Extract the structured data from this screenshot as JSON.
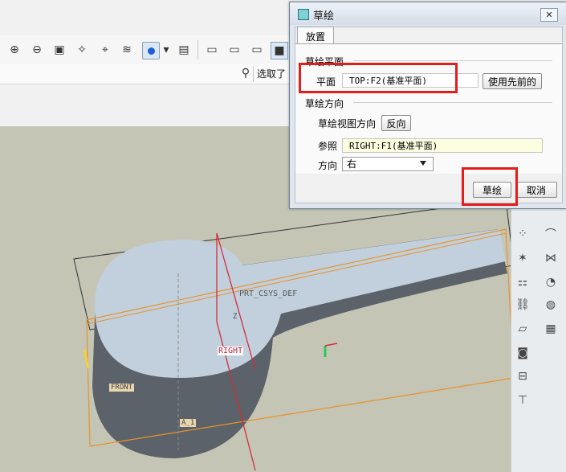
{
  "dialog": {
    "title": "草绘",
    "close_label": "✕",
    "tab": "放置",
    "section_plane": "草绘平面",
    "plane_label": "平面",
    "plane_value": "TOP:F2(基准平面)",
    "use_previous": "使用先前的",
    "section_orientation": "草绘方向",
    "view_direction_label": "草绘视图方向",
    "flip_button": "反向",
    "reference_label": "参照",
    "reference_value": "RIGHT:F1(基准平面)",
    "direction_label": "方向",
    "direction_value": "右",
    "sketch_button": "草绘",
    "cancel_button": "取消"
  },
  "toolbar": {
    "selection_label": "选取了",
    "icons": [
      "zoom-in-icon",
      "zoom-out-icon",
      "zoom-fit-icon",
      "repaint-icon",
      "spin-center-icon",
      "layers-icon",
      "named-views-icon",
      "view-manager-icon",
      "wireframe-icon",
      "hidden-line-icon",
      "no-hidden-icon",
      "shading-icon"
    ]
  },
  "model_labels": {
    "csys": "PRT_CSYS_DEF",
    "right": "RIGHT",
    "front": "FRONT",
    "axis": "A_1",
    "z": "Z"
  },
  "colors": {
    "highlight_red": "#e51c1c",
    "datum_orange": "#e8932b",
    "model_gray": "#5b6269",
    "model_face": "#c1d0dc"
  }
}
